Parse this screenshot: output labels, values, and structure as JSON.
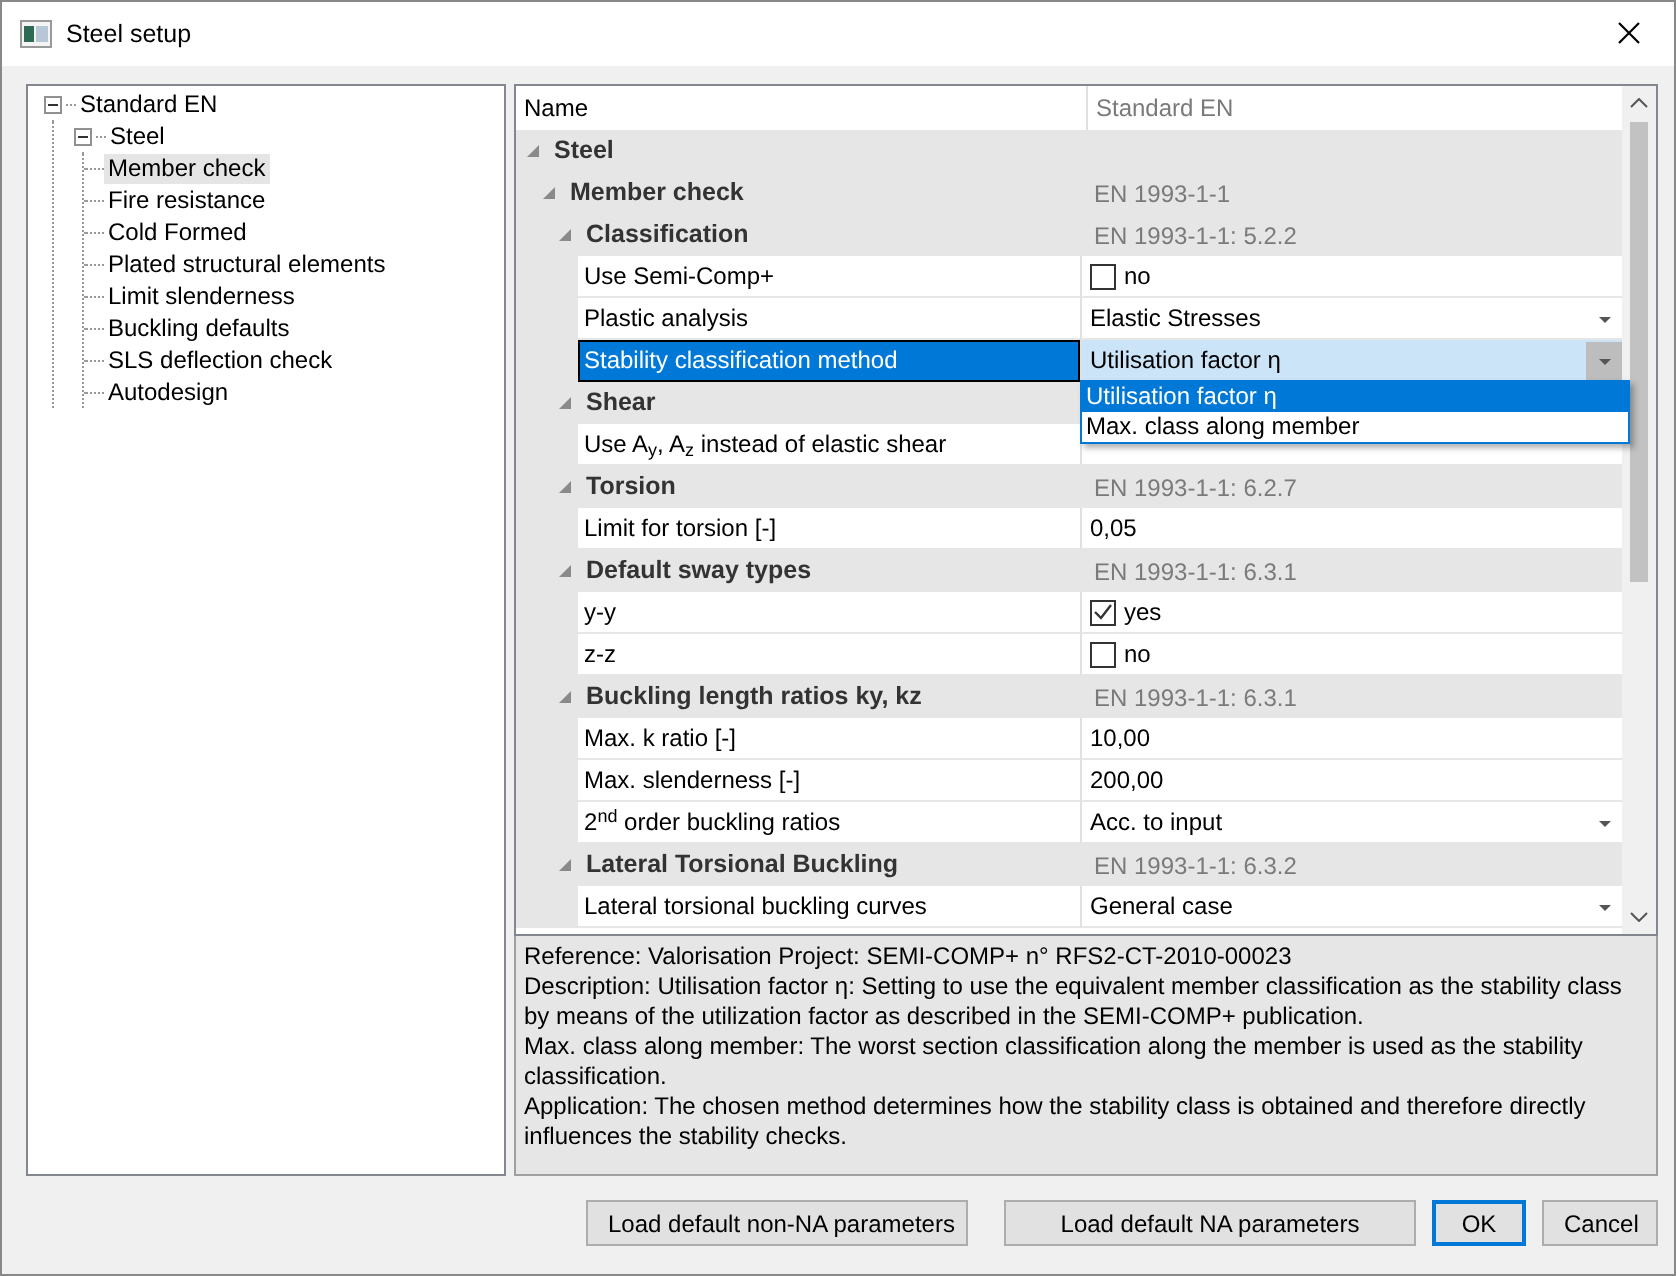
{
  "window": {
    "title": "Steel setup"
  },
  "tree": [
    {
      "label": "Standard EN",
      "expanded": true,
      "selected": false,
      "children": [
        {
          "label": "Steel",
          "expanded": true,
          "selected": false,
          "children": [
            {
              "label": "Member check",
              "selected": true
            },
            {
              "label": "Fire resistance",
              "selected": false
            },
            {
              "label": "Cold Formed",
              "selected": false
            },
            {
              "label": "Plated structural elements",
              "selected": false
            },
            {
              "label": "Limit slenderness",
              "selected": false
            },
            {
              "label": "Buckling defaults",
              "selected": false
            },
            {
              "label": "SLS deflection check",
              "selected": false
            },
            {
              "label": "Autodesign",
              "selected": false
            }
          ]
        }
      ]
    }
  ],
  "grid": {
    "columns": [
      "Name",
      "Standard EN"
    ],
    "rows": [
      {
        "kind": "category",
        "label": "Steel",
        "expanded": true,
        "children": [
          {
            "kind": "category",
            "label": "Member check",
            "value": "EN 1993-1-1",
            "expanded": true,
            "children": [
              {
                "kind": "category",
                "label": "Classification",
                "value": "EN 1993-1-1: 5.2.2",
                "expanded": true,
                "children": [
                  {
                    "kind": "checkbox",
                    "label": "Use Semi-Comp+",
                    "value": "no",
                    "checked": false,
                    "selected": false
                  },
                  {
                    "kind": "dropdown",
                    "label": "Plastic analysis",
                    "value": "Elastic Stresses",
                    "selected": false
                  },
                  {
                    "kind": "dropdown",
                    "label": "Stability classification method",
                    "value": "Utilisation factor η",
                    "selected": true,
                    "options": [
                      {
                        "label": "Utilisation factor η",
                        "selected": true
                      },
                      {
                        "label": "Max. class along member",
                        "selected": false
                      }
                    ]
                  }
                ]
              },
              {
                "kind": "category",
                "label": "Shear",
                "expanded": true,
                "children": [
                  {
                    "kind": "text",
                    "label": "Use A$_{y}$, A$_{z}$ instead of elastic shear",
                    "selected": false
                  }
                ]
              },
              {
                "kind": "category",
                "label": "Torsion",
                "value": "EN 1993-1-1: 6.2.7",
                "expanded": true,
                "children": [
                  {
                    "kind": "text",
                    "label": "Limit for torsion [-]",
                    "value": "0,05",
                    "selected": false
                  }
                ]
              },
              {
                "kind": "category",
                "label": "Default sway types",
                "value": "EN 1993-1-1: 6.3.1",
                "expanded": true,
                "children": [
                  {
                    "kind": "checkbox",
                    "label": "y-y",
                    "value": "yes",
                    "checked": true,
                    "selected": false
                  },
                  {
                    "kind": "checkbox",
                    "label": "z-z",
                    "value": "no",
                    "checked": false,
                    "selected": false
                  }
                ]
              },
              {
                "kind": "category",
                "label": "Buckling length ratios ky, kz",
                "value": "EN 1993-1-1: 6.3.1",
                "expanded": true,
                "children": [
                  {
                    "kind": "text",
                    "label": "Max. k ratio [-]",
                    "value": "10,00",
                    "selected": false
                  },
                  {
                    "kind": "text",
                    "label": "Max. slenderness [-]",
                    "value": "200,00",
                    "selected": false
                  },
                  {
                    "kind": "dropdown",
                    "label": "2$^{nd}$ order buckling ratios",
                    "value": "Acc. to input",
                    "selected": false
                  }
                ]
              },
              {
                "kind": "category",
                "label": "Lateral Torsional Buckling",
                "value": "EN 1993-1-1: 6.3.2",
                "expanded": true,
                "children": [
                  {
                    "kind": "dropdown",
                    "label": "Lateral torsional buckling curves",
                    "value": "General case",
                    "selected": false
                  }
                ]
              }
            ]
          }
        ]
      }
    ]
  },
  "description": [
    "Reference: Valorisation Project: SEMI-COMP+ n° RFS2-CT-2010-00023",
    "Description: Utilisation factor η: Setting to use the equivalent member classification as the stability class by means of the utilization factor as described in the SEMI-COMP+ publication.",
    "Max. class along member: The worst section classification along the member is used as the stability classification.",
    "Application: The chosen method determines how the stability class is obtained and therefore directly influences the stability checks."
  ],
  "buttons": [
    {
      "label": "Load default non-NA parameters",
      "default": false
    },
    {
      "label": "Load default NA parameters",
      "default": false
    },
    {
      "label": "OK",
      "default": true
    },
    {
      "label": "Cancel",
      "default": false
    }
  ]
}
